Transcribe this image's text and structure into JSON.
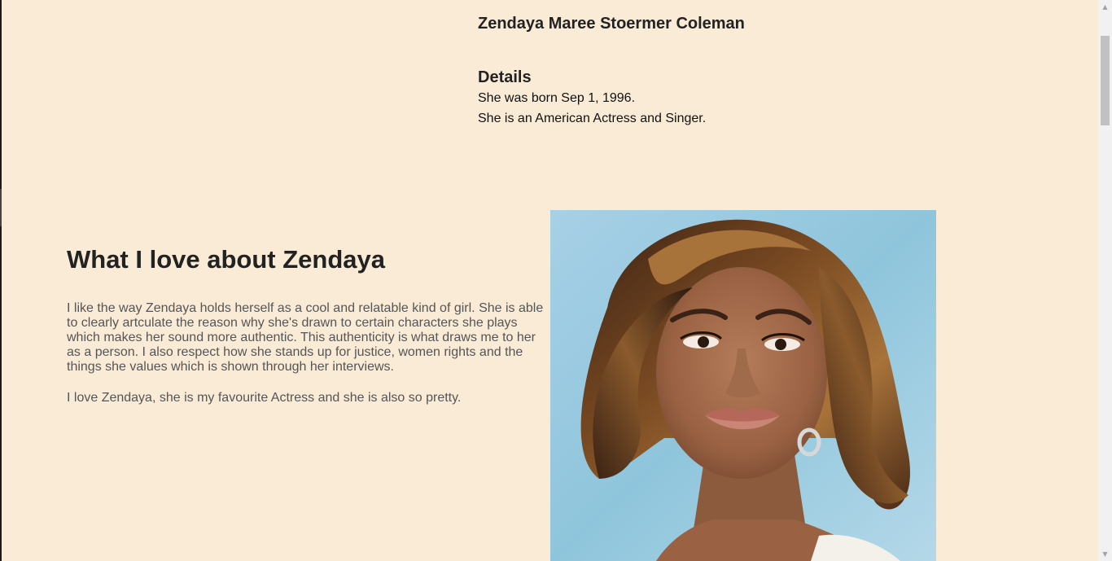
{
  "profile": {
    "full_name": "Zendaya Maree Stoermer Coleman",
    "details_heading": "Details",
    "details": [
      "She was born Sep 1, 1996.",
      "She is an American Actress and Singer."
    ]
  },
  "love_section": {
    "heading": "What I love about Zendaya",
    "paragraphs": [
      "I like the way Zendaya holds herself as a cool and relatable kind of girl. She is able to clearly artculate the reason why she's drawn to certain characters she plays which makes her sound more authentic. This authenticity is what draws me to her as a person. I also respect how she stands up for justice, women rights and the things she values which is shown through her interviews.",
      "I love Zendaya, she is my favourite Actress and she is also so pretty."
    ],
    "image": {
      "alt": "Zendaya portrait"
    }
  },
  "colors": {
    "page_background": "#faebd7",
    "heading_text": "#222222",
    "paragraph_text": "#555555"
  },
  "scrollbar": {
    "up_icon": "triangle-up-icon",
    "down_icon": "triangle-down-icon"
  }
}
